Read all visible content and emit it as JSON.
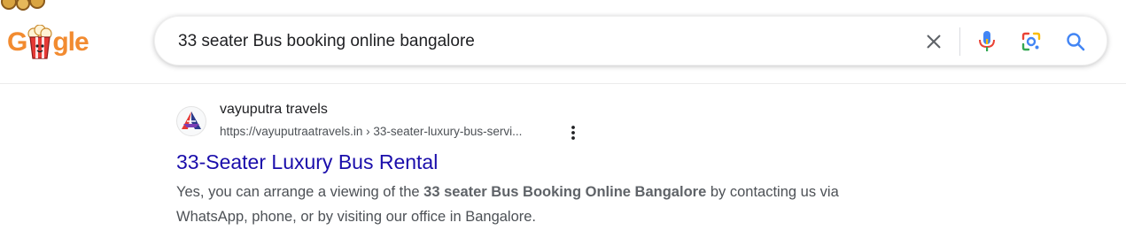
{
  "header": {
    "logo": {
      "letters_before": "G",
      "letters_after": "gle"
    },
    "search": {
      "query": "33 seater Bus booking online bangalore"
    },
    "icons": {
      "clear": "close-icon",
      "voice": "microphone-icon",
      "lens": "camera-lens-icon",
      "search": "search-icon"
    }
  },
  "result": {
    "site_name": "vayuputra travels",
    "url": "https://vayuputraatravels.in › 33-seater-luxury-bus-servi...",
    "title": "33-Seater Luxury Bus Rental",
    "snippet": {
      "before": "Yes, you can arrange a viewing of the ",
      "bold": "33 seater Bus Booking Online Bangalore",
      "after": " by contacting us via WhatsApp, phone, or by visiting our office in Bangalore."
    }
  },
  "colors": {
    "link": "#1a0dab",
    "logo": "#f28b30",
    "search_icon": "#4285f4"
  }
}
